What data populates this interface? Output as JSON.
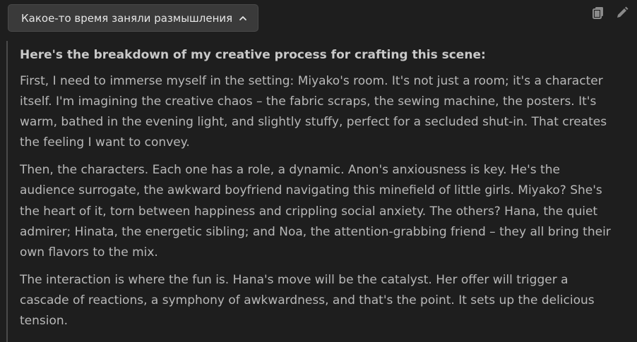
{
  "thinking": {
    "toggle_label": "Какое-то время заняли размышления",
    "toggle_icon": "chevron-up-icon"
  },
  "toolbar": {
    "icons": [
      "copy-icon",
      "edit-pencil-icon"
    ],
    "icon_color": "#8a8a8a"
  },
  "content": {
    "heading": "Here's the breakdown of my creative process for crafting this scene:",
    "paragraphs": [
      "First, I need to immerse myself in the setting: Miyako's room. It's not just a room; it's a character itself. I'm imagining the creative chaos – the fabric scraps, the sewing machine, the posters. It's warm, bathed in the evening light, and slightly stuffy, perfect for a secluded shut-in. That creates the feeling I want to convey.",
      "Then, the characters. Each one has a role, a dynamic. Anon's anxiousness is key. He's the audience surrogate, the awkward boyfriend navigating this minefield of little girls. Miyako? She's the heart of it, torn between happiness and crippling social anxiety. The others? Hana, the quiet admirer; Hinata, the energetic sibling; and Noa, the attention-grabbing friend – they all bring their own flavors to the mix.",
      "The interaction is where the fun is. Hana's move will be the catalyst. Her offer will trigger a cascade of reactions, a symphony of awkwardness, and that's the point. It sets up the delicious tension."
    ]
  },
  "colors": {
    "background": "#1e1e1e",
    "toggle_bg": "#3a3a3a",
    "text": "#b8b8b8",
    "heading": "#c9c9c9",
    "border": "#4a4a4a"
  }
}
